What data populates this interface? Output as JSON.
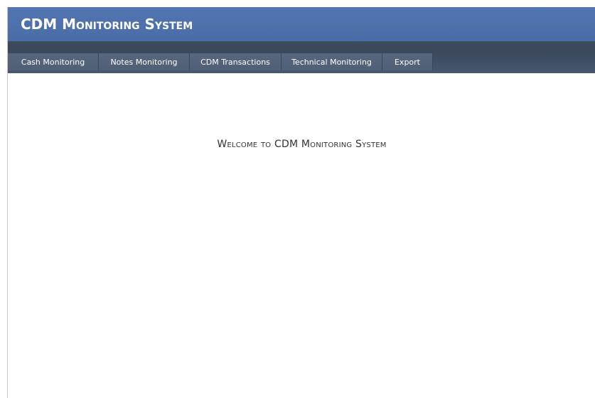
{
  "header": {
    "title": "CDM Monitoring System"
  },
  "nav": {
    "items": [
      {
        "label": "Cash Monitoring"
      },
      {
        "label": "Notes Monitoring"
      },
      {
        "label": "CDM Transactions"
      },
      {
        "label": "Technical Monitoring"
      },
      {
        "label": "Export"
      }
    ]
  },
  "main": {
    "welcome_text": "Welcome to CDM Monitoring System"
  },
  "colors": {
    "header_bg": "#4f72ae",
    "menubar_bg": "#3c495b",
    "nav_item_bg": "#55647a",
    "text_dark": "#333333"
  }
}
